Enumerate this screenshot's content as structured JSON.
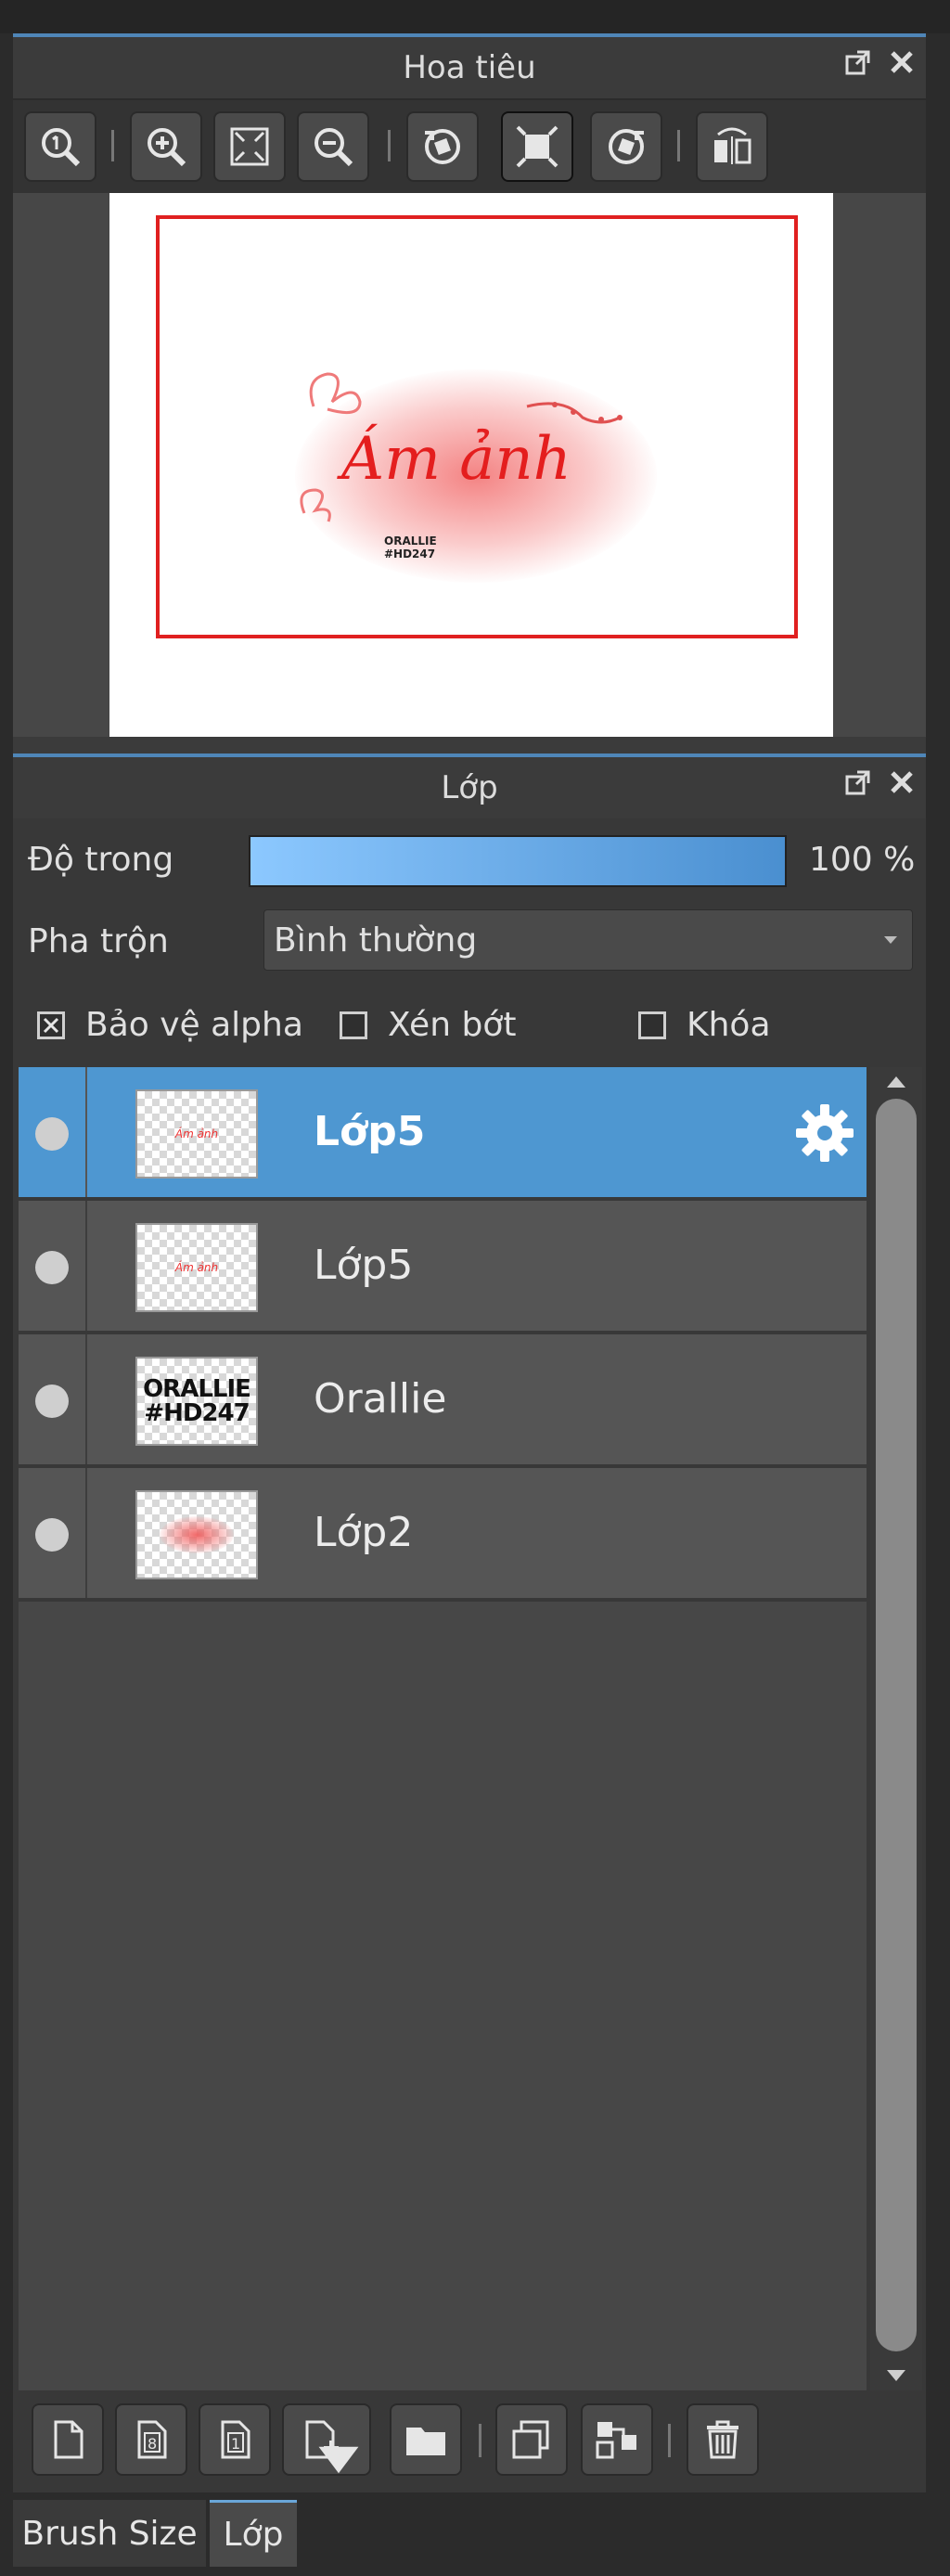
{
  "navigator": {
    "title": "Hoa tiêu",
    "canvas_text": "Ám ảnh",
    "watermark_line1": "ORALLIE",
    "watermark_line2": "#HD247",
    "tools": [
      "zoom-reset-icon",
      "zoom-in-icon",
      "fit-screen-icon",
      "zoom-out-icon",
      "rotate-left-icon",
      "actual-size-icon",
      "rotate-right-icon",
      "flip-icon"
    ]
  },
  "layers": {
    "title": "Lớp",
    "opacity_label": "Độ trong",
    "opacity_value": "100 %",
    "opacity_fraction": 1.0,
    "blend_label": "Pha trộn",
    "blend_value": "Bình thường",
    "protect_alpha_label": "Bảo vệ alpha",
    "protect_alpha_checked": true,
    "clip_label": "Xén bớt",
    "clip_checked": false,
    "lock_label": "Khóa",
    "lock_checked": false,
    "items": [
      {
        "name": "Lớp5",
        "selected": true
      },
      {
        "name": "Lớp5",
        "selected": false
      },
      {
        "name": "Orallie",
        "selected": false
      },
      {
        "name": "Lớp2",
        "selected": false
      }
    ],
    "thumb_orallie_line1": "ORALLIE",
    "thumb_orallie_line2": "#HD247"
  },
  "tabs": {
    "brush_size": "Brush Size",
    "layer": "Lớp"
  },
  "colors": {
    "accent": "#4e97d1",
    "frame_red": "#e02020"
  }
}
